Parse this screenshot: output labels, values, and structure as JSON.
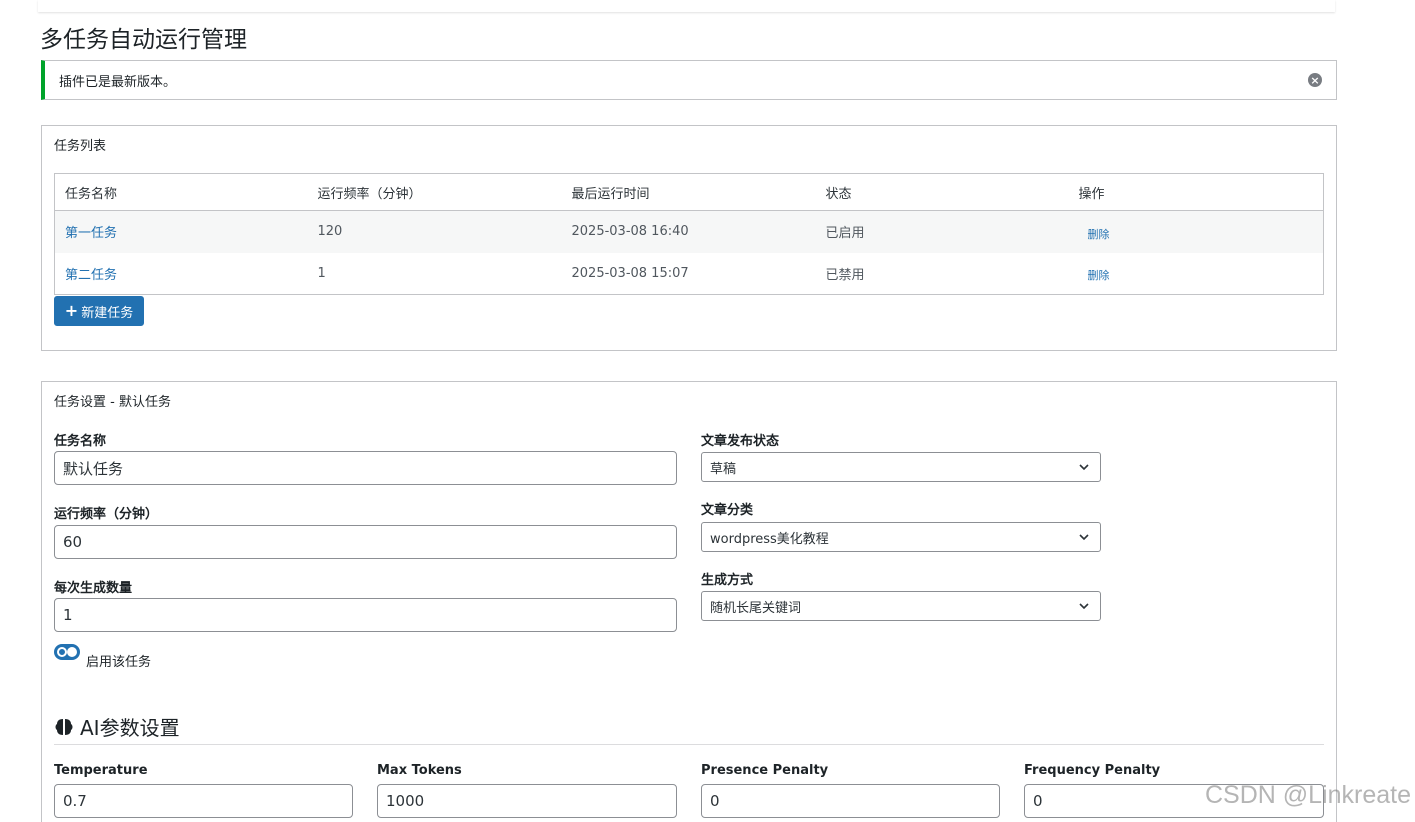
{
  "page": {
    "title": "多任务自动运行管理"
  },
  "notice": {
    "text": "插件已是最新版本。"
  },
  "task_list": {
    "heading": "任务列表",
    "columns": [
      "任务名称",
      "运行频率（分钟）",
      "最后运行时间",
      "状态",
      "操作"
    ],
    "rows": [
      {
        "name": "第一任务",
        "frequency": "120",
        "last_run": "2025-03-08 16:40",
        "status": "已启用",
        "action": "删除"
      },
      {
        "name": "第二任务",
        "frequency": "1",
        "last_run": "2025-03-08 15:07",
        "status": "已禁用",
        "action": "删除"
      }
    ],
    "new_button": "新建任务"
  },
  "settings": {
    "heading": "任务设置 - 默认任务",
    "task_name": {
      "label": "任务名称",
      "value": "默认任务"
    },
    "frequency": {
      "label": "运行频率（分钟）",
      "value": "60"
    },
    "count": {
      "label": "每次生成数量",
      "value": "1"
    },
    "enable": {
      "label": "启用该任务",
      "checked": true
    },
    "publish_status": {
      "label": "文章发布状态",
      "value": "草稿"
    },
    "category": {
      "label": "文章分类",
      "value": "wordpress美化教程"
    },
    "method": {
      "label": "生成方式",
      "value": "随机长尾关键词"
    }
  },
  "ai": {
    "title": "AI参数设置",
    "fields": [
      {
        "label": "Temperature",
        "value": "0.7"
      },
      {
        "label": "Max Tokens",
        "value": "1000"
      },
      {
        "label": "Presence Penalty",
        "value": "0"
      },
      {
        "label": "Frequency Penalty",
        "value": "0"
      }
    ]
  },
  "watermark": "CSDN @Linkreate",
  "colors": {
    "accent": "#2271b1",
    "success": "#00a32a",
    "border": "#c3c4c7"
  }
}
